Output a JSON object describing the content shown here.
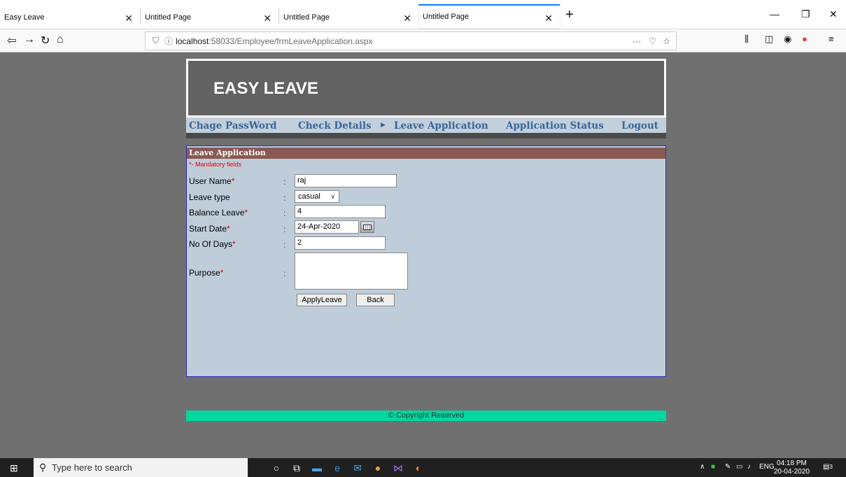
{
  "browser": {
    "tabs": [
      {
        "label": "Easy Leave",
        "active": false
      },
      {
        "label": "Untitled Page",
        "active": false
      },
      {
        "label": "Untitled Page",
        "active": false
      },
      {
        "label": "Untitled Page",
        "active": true
      }
    ],
    "url_host": "localhost",
    "url_path": ":58033/Employee/frmLeaveApplication.aspx",
    "new_tab_icon": "plus-icon"
  },
  "site": {
    "title": "EASY LEAVE",
    "menu": {
      "change_password": "Chage PassWord",
      "check_details": "Check Details",
      "leave_application": "Leave Application",
      "application_status": "Application Status",
      "logout": "Logout"
    },
    "footer": "© Copyright Reserved"
  },
  "form": {
    "heading": "Leave Application",
    "mandatory_note": "*- Mandatory fields",
    "colon": ":",
    "required_marker": "*",
    "user_name_label": "User Name",
    "user_name_value": "raj",
    "leave_type_label": "Leave type",
    "leave_type_value": "casual",
    "balance_leave_label": "Balance Leave",
    "balance_leave_value": "4",
    "start_date_label": "Start Date",
    "start_date_value": "24-Apr-2020",
    "no_of_days_label": "No Of Days",
    "no_of_days_value": "2",
    "purpose_label": "Purpose",
    "purpose_value": "",
    "apply_button": "ApplyLeave",
    "back_button": "Back"
  },
  "taskbar": {
    "search_placeholder": "Type here to search",
    "language": "ENG",
    "time": "04:18 PM",
    "date": "20-04-2020",
    "notification_count": "3"
  },
  "colors": {
    "banner": "#626262",
    "menu_text": "#37669c",
    "panel_bg": "#bfcdda",
    "panel_head": "#8a5a52",
    "required": "#e00000",
    "footer": "#00d8a0"
  }
}
